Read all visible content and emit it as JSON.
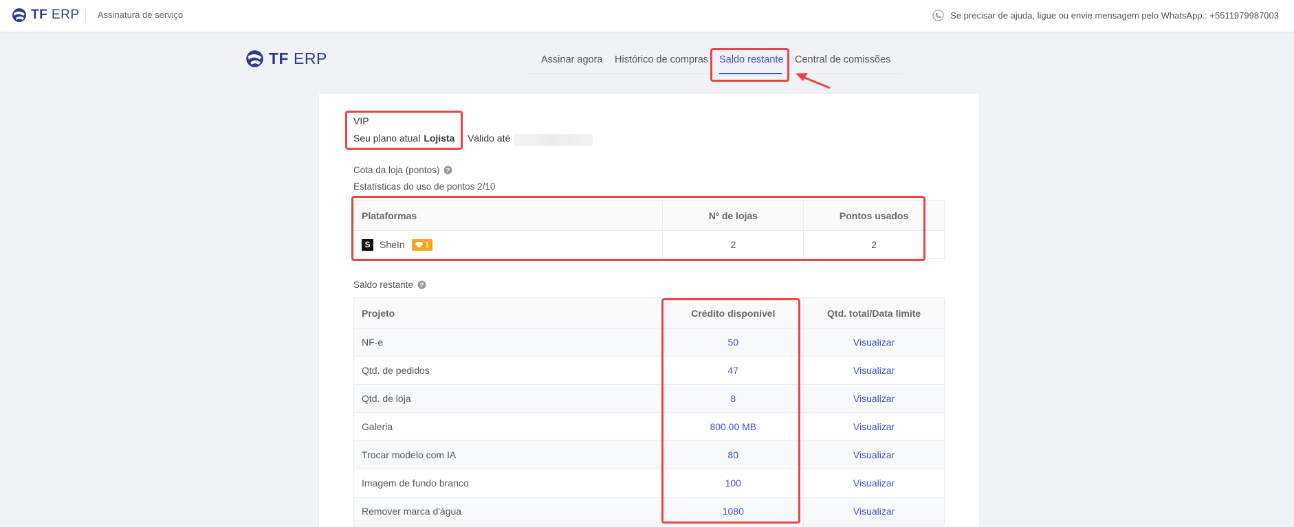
{
  "topbar": {
    "logo_tf": "TF",
    "logo_erp": "ERP",
    "subtitle": "Assinatura de serviço",
    "help_text": "Se precisar de ajuda, ligue ou envie mensagem pelo WhatsApp.: +5511979987003"
  },
  "header": {
    "logo_tf": "TF",
    "logo_erp": "ERP",
    "tabs": [
      {
        "label": "Assinar agora"
      },
      {
        "label": "Histórico de compras"
      },
      {
        "label": "Saldo restante",
        "active": true
      },
      {
        "label": "Central de comissões"
      }
    ]
  },
  "plan": {
    "tier": "VIP",
    "current_label": "Seu plano atual",
    "current_value": "Lojista",
    "valid_label": "Válido até"
  },
  "quota": {
    "title": "Cota da loja (pontos)",
    "stats": "Estatísticas do uso de pontos 2/10",
    "headers": [
      "Plataformas",
      "Nº de lojas",
      "Pontos usados"
    ],
    "row": {
      "platform": "SheIn",
      "logo_letter": "S",
      "badge": "1",
      "stores": "2",
      "points": "2"
    }
  },
  "balance": {
    "title": "Saldo restante",
    "headers": [
      "Projeto",
      "Crédito disponível",
      "Qtd. total/Data limite"
    ],
    "rows": [
      {
        "project": "NF-e",
        "credit": "50",
        "action": "Visualizar"
      },
      {
        "project": "Qtd. de pedidos",
        "credit": "47",
        "action": "Visualizar"
      },
      {
        "project": "Qtd. de loja",
        "credit": "8",
        "action": "Visualizar"
      },
      {
        "project": "Galeria",
        "credit": "800.00 MB",
        "action": "Visualizar"
      },
      {
        "project": "Trocar modelo com IA",
        "credit": "80",
        "action": "Visualizar"
      },
      {
        "project": "Imagem de fundo branco",
        "credit": "100",
        "action": "Visualizar"
      },
      {
        "project": "Remover marca d'água",
        "credit": "1080",
        "action": "Visualizar"
      }
    ]
  },
  "colors": {
    "accent": "#3f51c5",
    "highlight": "#e84646",
    "badge": "#f5a623"
  }
}
